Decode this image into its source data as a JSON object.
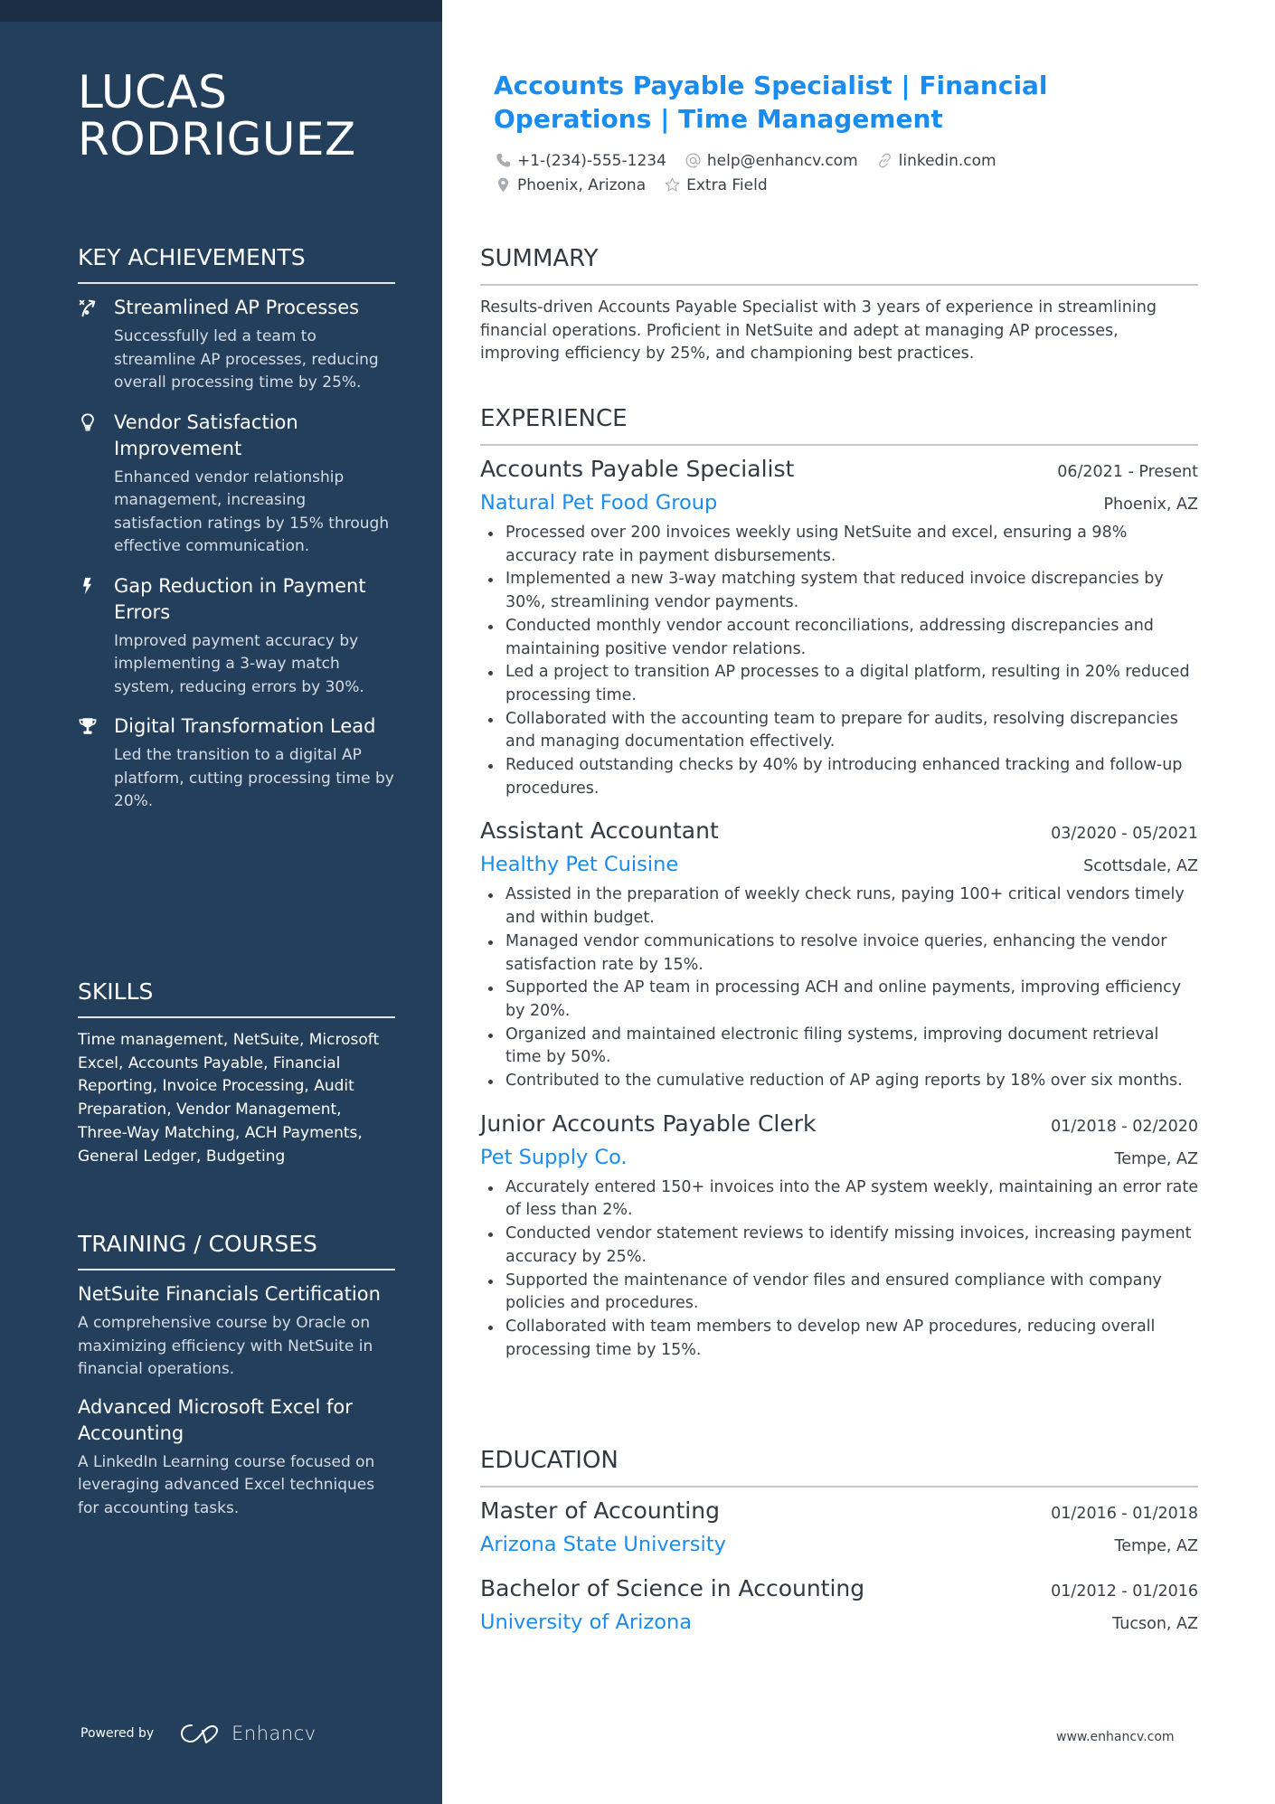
{
  "colors": {
    "sidebar_bg": "#243f5c",
    "sidebar_topband": "#1b2e44",
    "accent": "#1a8cf0",
    "text": "#3a4148",
    "heading": "#313a42"
  },
  "sidebar": {
    "name_line1": "LUCAS",
    "name_line2": "RODRIGUEZ",
    "key_achievements": {
      "heading": "KEY ACHIEVEMENTS",
      "items": [
        {
          "icon": "strategy-icon",
          "title": "Streamlined AP Processes",
          "description": "Successfully led a team to streamline AP processes, reducing overall processing time by 25%."
        },
        {
          "icon": "lightbulb-icon",
          "title": "Vendor Satisfaction Improvement",
          "description": "Enhanced vendor relationship management, increasing satisfaction ratings by 15% through effective communication."
        },
        {
          "icon": "lightning-icon",
          "title": "Gap Reduction in Payment Errors",
          "description": "Improved payment accuracy by implementing a 3-way match system, reducing errors by 30%."
        },
        {
          "icon": "trophy-icon",
          "title": "Digital Transformation Lead",
          "description": "Led the transition to a digital AP platform, cutting processing time by 20%."
        }
      ]
    },
    "skills": {
      "heading": "SKILLS",
      "text": "Time management, NetSuite, Microsoft Excel, Accounts Payable, Financial Reporting, Invoice Processing, Audit Preparation, Vendor Management, Three-Way Matching, ACH Payments, General Ledger, Budgeting"
    },
    "training": {
      "heading": "TRAINING / COURSES",
      "items": [
        {
          "title": "NetSuite Financials Certification",
          "description": "A comprehensive course by Oracle on maximizing efficiency with NetSuite in financial operations."
        },
        {
          "title": "Advanced Microsoft Excel for Accounting",
          "description": "A LinkedIn Learning course focused on leveraging advanced Excel techniques for accounting tasks."
        }
      ]
    },
    "footer": {
      "powered_by": "Powered by",
      "brand": "Enhancv"
    }
  },
  "main": {
    "headline": "Accounts Payable Specialist | Financial Operations | Time Management",
    "contacts": {
      "phone": "+1-(234)-555-1234",
      "email": "help@enhancv.com",
      "link": "linkedin.com",
      "location": "Phoenix, Arizona",
      "extra": "Extra Field"
    },
    "summary": {
      "heading": "SUMMARY",
      "text": "Results-driven Accounts Payable Specialist with 3 years of experience in streamlining financial operations. Proficient in NetSuite and adept at managing AP processes, improving efficiency by 25%, and championing best practices."
    },
    "experience": {
      "heading": "EXPERIENCE",
      "jobs": [
        {
          "role": "Accounts Payable Specialist",
          "dates": "06/2021 - Present",
          "company": "Natural Pet Food Group",
          "location": "Phoenix, AZ",
          "bullets": [
            "Processed over 200 invoices weekly using NetSuite and excel, ensuring a 98% accuracy rate in payment disbursements.",
            "Implemented a new 3-way matching system that reduced invoice discrepancies by 30%, streamlining vendor payments.",
            "Conducted monthly vendor account reconciliations, addressing discrepancies and maintaining positive vendor relations.",
            "Led a project to transition AP processes to a digital platform, resulting in 20% reduced processing time.",
            "Collaborated with the accounting team to prepare for audits, resolving discrepancies and managing documentation effectively.",
            "Reduced outstanding checks by 40% by introducing enhanced tracking and follow-up procedures."
          ]
        },
        {
          "role": "Assistant Accountant",
          "dates": "03/2020 - 05/2021",
          "company": "Healthy Pet Cuisine",
          "location": "Scottsdale, AZ",
          "bullets": [
            "Assisted in the preparation of weekly check runs, paying 100+ critical vendors timely and within budget.",
            "Managed vendor communications to resolve invoice queries, enhancing the vendor satisfaction rate by 15%.",
            "Supported the AP team in processing ACH and online payments, improving efficiency by 20%.",
            "Organized and maintained electronic filing systems, improving document retrieval time by 50%.",
            "Contributed to the cumulative reduction of AP aging reports by 18% over six months."
          ]
        },
        {
          "role": "Junior Accounts Payable Clerk",
          "dates": "01/2018 - 02/2020",
          "company": "Pet Supply Co.",
          "location": "Tempe, AZ",
          "bullets": [
            "Accurately entered 150+ invoices into the AP system weekly, maintaining an error rate of less than 2%.",
            "Conducted vendor statement reviews to identify missing invoices, increasing payment accuracy by 25%.",
            "Supported the maintenance of vendor files and ensured compliance with company policies and procedures.",
            "Collaborated with team members to develop new AP procedures, reducing overall processing time by 15%."
          ]
        }
      ]
    },
    "education": {
      "heading": "EDUCATION",
      "items": [
        {
          "degree": "Master of Accounting",
          "dates": "01/2016 - 01/2018",
          "school": "Arizona State University",
          "location": "Tempe, AZ"
        },
        {
          "degree": "Bachelor of Science in Accounting",
          "dates": "01/2012 - 01/2016",
          "school": "University of Arizona",
          "location": "Tucson, AZ"
        }
      ]
    },
    "site": "www.enhancv.com"
  }
}
